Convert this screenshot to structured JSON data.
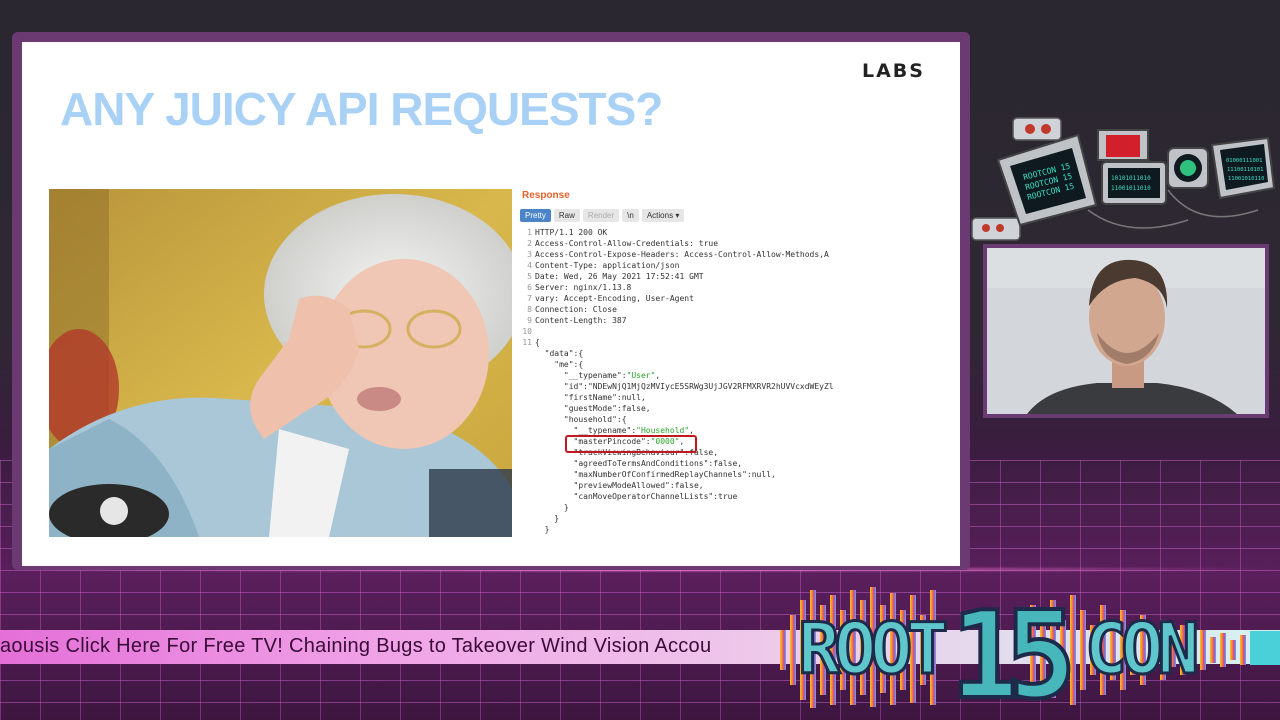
{
  "slide": {
    "title": "ANY JUICY API REQUESTS?",
    "brand_logo": "LABS"
  },
  "response_panel": {
    "label": "Response",
    "tabs": [
      {
        "label": "Pretty",
        "active": true
      },
      {
        "label": "Raw",
        "active": false
      },
      {
        "label": "Render",
        "active": false
      },
      {
        "label": "\\n",
        "active": false
      },
      {
        "label": "Actions",
        "active": false
      }
    ],
    "lines": [
      {
        "n": "1",
        "text": "HTTP/1.1 200 OK"
      },
      {
        "n": "2",
        "text": "Access-Control-Allow-Credentials: true"
      },
      {
        "n": "3",
        "text": "Access-Control-Expose-Headers: Access-Control-Allow-Methods,A"
      },
      {
        "n": "4",
        "text": "Content-Type: application/json"
      },
      {
        "n": "5",
        "text": "Date: Wed, 26 May 2021 17:52:41 GMT"
      },
      {
        "n": "6",
        "text": "Server: nginx/1.13.8"
      },
      {
        "n": "7",
        "text": "vary: Accept-Encoding, User-Agent"
      },
      {
        "n": "8",
        "text": "Connection: Close"
      },
      {
        "n": "9",
        "text": "Content-Length: 387"
      },
      {
        "n": "10",
        "text": ""
      },
      {
        "n": "11",
        "text": "{"
      },
      {
        "n": "",
        "text": "  \"data\":{"
      },
      {
        "n": "",
        "text": "    \"me\":{"
      },
      {
        "n": "",
        "text": "      \"__typename\":\"User\","
      },
      {
        "n": "",
        "text": "      \"id\":\"NDEwNjQ1MjQzMVIycE5SRWg3UjJGV2RFMXRVR2hUVVcxdWEyZl"
      },
      {
        "n": "",
        "text": "      \"firstName\":null,"
      },
      {
        "n": "",
        "text": "      \"guestMode\":false,"
      },
      {
        "n": "",
        "text": "      \"household\":{"
      },
      {
        "n": "",
        "text": "        \"__typename\":\"Household\","
      },
      {
        "n": "",
        "text": "        \"masterPincode\":\"0000\","
      },
      {
        "n": "",
        "text": "        \"trackViewingBehaviour\":false,"
      },
      {
        "n": "",
        "text": "        \"agreedToTermsAndConditions\":false,"
      },
      {
        "n": "",
        "text": "        \"maxNumberOfConfirmedReplayChannels\":null,"
      },
      {
        "n": "",
        "text": "        \"previewModeAllowed\":false,"
      },
      {
        "n": "",
        "text": "        \"canMoveOperatorChannelLists\":true"
      },
      {
        "n": "",
        "text": "      }"
      },
      {
        "n": "",
        "text": "    }"
      },
      {
        "n": "",
        "text": "  }"
      }
    ]
  },
  "ticker": {
    "text": "aousis  Click Here For Free TV! Chaining Bugs to Takeover Wind Vision Accou"
  },
  "event_logo": {
    "left": "ROOT",
    "number": "15",
    "right": "CON"
  },
  "robots": {
    "screen_texts": [
      "ROOTCON 15",
      "ROOTCON 15",
      "ROOTCON 15"
    ],
    "binary_a": "10101011010\n11001011010",
    "binary_b": "01000111001\n11100110101\n11001010110"
  },
  "colors": {
    "title": "#a8d1f5",
    "highlight": "#c0181f",
    "response_label": "#e8632c",
    "ticker_bg": "#e46fd8",
    "logo_teal": "#58c7c9"
  }
}
